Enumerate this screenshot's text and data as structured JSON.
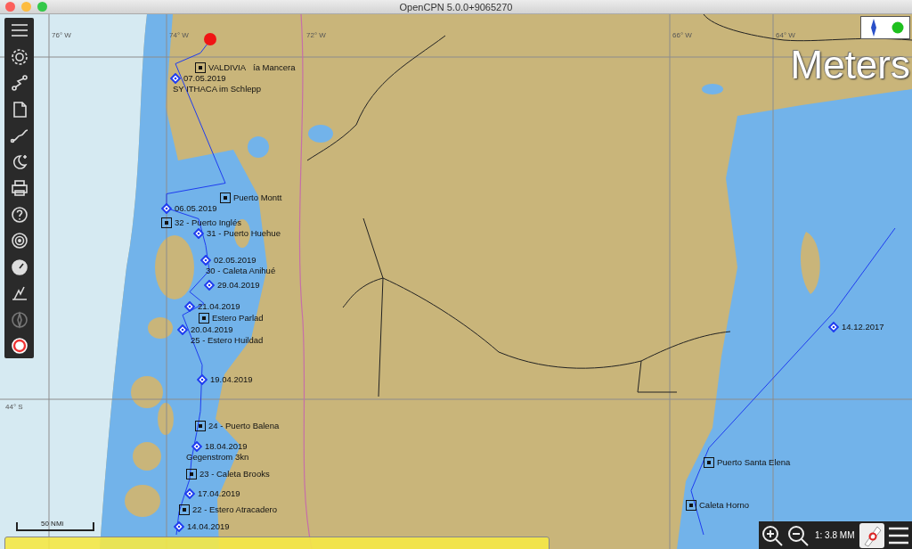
{
  "window": {
    "title": "OpenCPN 5.0.0+9065270"
  },
  "map": {
    "units_watermark": "Meters",
    "grid_labels": [
      "76° W",
      "74° W",
      "72° W",
      "66° W",
      "64° W",
      "44° S"
    ],
    "labels": [
      {
        "text": "VALDIVIA",
        "kind": "mark"
      },
      {
        "text": "ía Mancera",
        "kind": "note"
      },
      {
        "text": "07.05.2019",
        "kind": "route_point"
      },
      {
        "text": "SY ITHACA im Schlepp",
        "kind": "note"
      },
      {
        "text": "Puerto Montt",
        "kind": "mark"
      },
      {
        "text": "06.05.2019",
        "kind": "route_point"
      },
      {
        "text": "32 - Puerto Inglés",
        "kind": "mark"
      },
      {
        "text": "31 - Puerto Huehue",
        "kind": "route_point"
      },
      {
        "text": "02.05.2019",
        "kind": "route_point"
      },
      {
        "text": "30 - Caleta Anihué",
        "kind": "note"
      },
      {
        "text": "29.04.2019",
        "kind": "route_point"
      },
      {
        "text": "21.04.2019",
        "kind": "route_point"
      },
      {
        "text": "Estero Parlad",
        "kind": "mark"
      },
      {
        "text": "20.04.2019",
        "kind": "route_point"
      },
      {
        "text": "25 - Estero Huildad",
        "kind": "note"
      },
      {
        "text": "19.04.2019",
        "kind": "route_point"
      },
      {
        "text": "24 - Puerto Balena",
        "kind": "mark"
      },
      {
        "text": "18.04.2019",
        "kind": "route_point"
      },
      {
        "text": "Gegenstrom 3kn",
        "kind": "note"
      },
      {
        "text": "23 - Caleta Brooks",
        "kind": "mark"
      },
      {
        "text": "17.04.2019",
        "kind": "route_point"
      },
      {
        "text": "22 - Estero Atracadero",
        "kind": "mark"
      },
      {
        "text": "14.04.2019",
        "kind": "route_point"
      },
      {
        "text": "14.12.2017",
        "kind": "route_point"
      },
      {
        "text": "Puerto Santa Elena",
        "kind": "mark"
      },
      {
        "text": "Caleta Horno",
        "kind": "mark"
      }
    ],
    "scale_bar": "50 NMi"
  },
  "zoom_bar": {
    "scale": "1: 3.8 MM"
  }
}
